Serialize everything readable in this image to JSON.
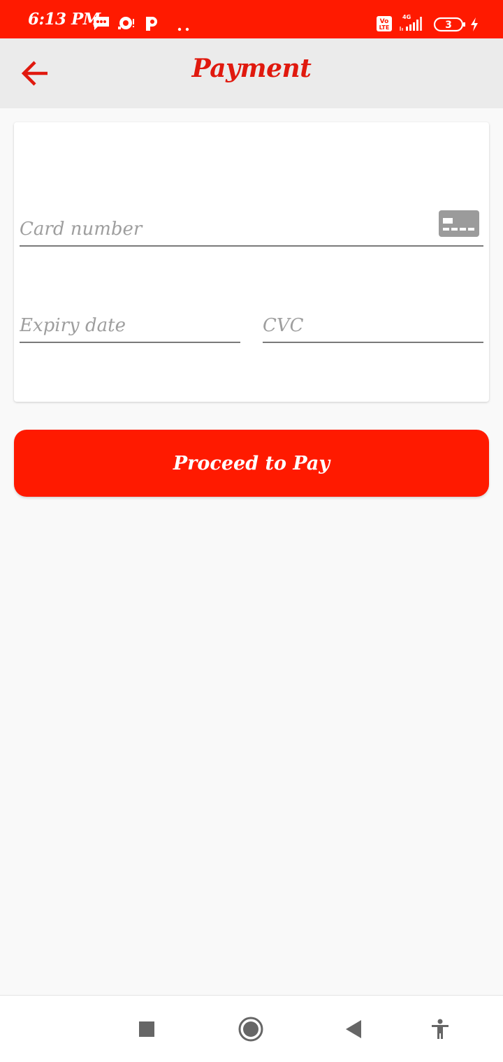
{
  "status_bar": {
    "time": "6:13 PM",
    "battery_level": "3",
    "network": "4G",
    "volte": "Vo LTE",
    "icons": [
      "message-icon",
      "notification-icon",
      "p-app-icon",
      "more-dots-icon",
      "volte-icon",
      "signal-icon",
      "battery-icon",
      "charging-icon"
    ]
  },
  "app_bar": {
    "title": "Payment",
    "back_icon": "arrow-left-icon"
  },
  "form": {
    "card_number": {
      "value": "",
      "placeholder": "Card number"
    },
    "expiry_date": {
      "value": "",
      "placeholder": "Expiry date"
    },
    "cvc": {
      "value": "",
      "placeholder": "CVC"
    }
  },
  "actions": {
    "pay_label": "Proceed to Pay"
  },
  "nav_bar": {
    "items": [
      "recents-square-icon",
      "home-circle-icon",
      "back-triangle-icon",
      "accessibility-icon"
    ]
  },
  "colors": {
    "accent": "#ff1a00",
    "title": "#e0190e",
    "app_bar_bg": "#ebebeb",
    "background": "#f9f9f9",
    "placeholder": "#9e9e9e"
  }
}
